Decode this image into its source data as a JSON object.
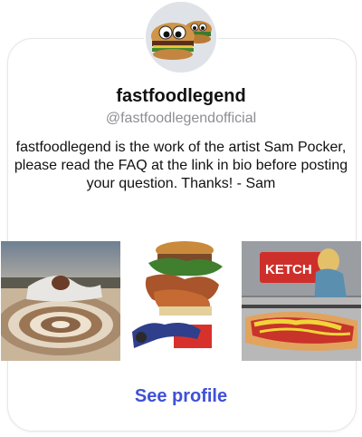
{
  "profile": {
    "display_name": "fastfoodlegend",
    "handle": "@fastfoodlegendofficial",
    "bio": "fastfoodlegend is the work of the artist Sam Pocker, please read the FAQ at the link in bio before posting your question. Thanks! - Sam",
    "avatar_icon": "burger-with-googly-eyes"
  },
  "posts": [
    {
      "name": "swirl-food-collage"
    },
    {
      "name": "burger-tower-collage"
    },
    {
      "name": "ketchup-hotdog-collage",
      "sign_text": "KETCH"
    }
  ],
  "actions": {
    "see_profile_label": "See profile",
    "link_color": "#3f51d6"
  }
}
